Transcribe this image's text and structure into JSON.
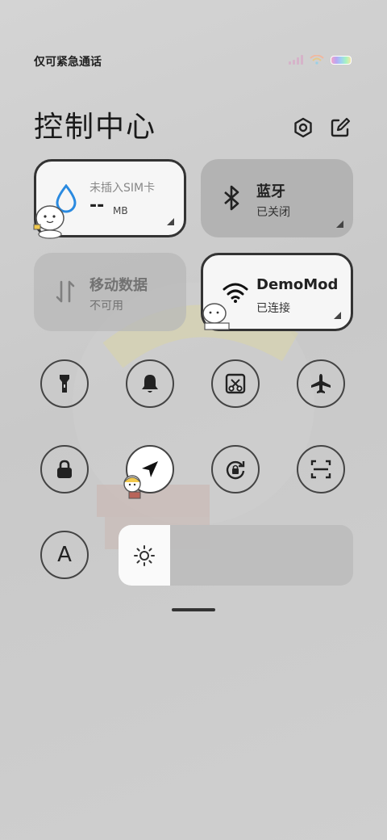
{
  "status_bar": {
    "carrier_text": "仅可紧急通话"
  },
  "header": {
    "title": "控制中心"
  },
  "tiles": {
    "data": {
      "title": "未插入SIM卡",
      "value": "--",
      "unit": "MB",
      "active": true
    },
    "bluetooth": {
      "name": "蓝牙",
      "status": "已关闭",
      "active": false
    },
    "mobile_data": {
      "name": "移动数据",
      "status": "不可用",
      "active": false
    },
    "wifi": {
      "name": "DemoMod",
      "status": "已连接",
      "active": true
    }
  },
  "toggles": {
    "row1": [
      "flashlight-icon",
      "bell-icon",
      "screenshot-icon",
      "airplane-icon"
    ],
    "row2": [
      "lock-icon",
      "location-icon",
      "rotation-lock-icon",
      "scan-icon"
    ],
    "auto_brightness": {
      "label": "A"
    }
  },
  "brightness": {
    "level": 0.22
  },
  "colors": {
    "accent_blue": "#2a8ae0",
    "tile_active": "#f6f6f6",
    "tile_inactive": "#b3b3b3"
  }
}
